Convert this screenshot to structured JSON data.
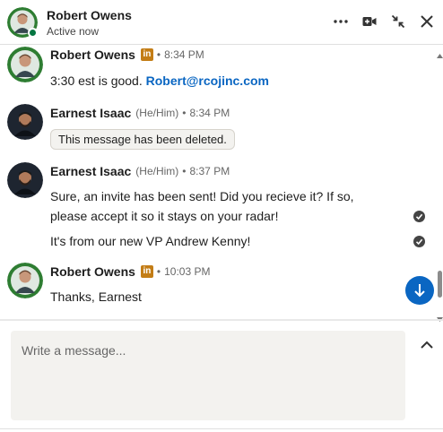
{
  "header": {
    "name": "Robert Owens",
    "status": "Active now",
    "icons": [
      "more-options-icon",
      "video-call-icon",
      "minimize-icon",
      "close-icon"
    ]
  },
  "messages": [
    {
      "sender": "Robert Owens",
      "badge": "in",
      "time": "8:34 PM",
      "text": "3:30 est is good.",
      "link": "Robert@rcojinc.com"
    },
    {
      "sender": "Earnest Isaac",
      "pronoun": "(He/Him)",
      "time": "8:34 PM",
      "deleted": "This message has been deleted."
    },
    {
      "sender": "Earnest Isaac",
      "pronoun": "(He/Him)",
      "time": "8:37 PM",
      "lines": [
        "Sure, an invite has been sent! Did you recieve it? If so,",
        "please accept it so it stays on your radar!",
        "It's from our new VP Andrew Kenny!"
      ]
    },
    {
      "sender": "Robert Owens",
      "badge": "in",
      "time": "10:03 PM",
      "text": "Thanks, Earnest"
    }
  ],
  "composer": {
    "placeholder": "Write a message..."
  },
  "colors": {
    "accent": "#0a66c2",
    "presence": "#057642",
    "badge": "#c37d16"
  }
}
